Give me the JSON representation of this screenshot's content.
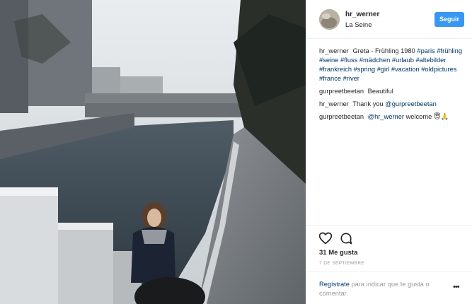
{
  "post": {
    "author": "hr_werner",
    "location": "La Seine",
    "follow_label": "Seguir",
    "caption": {
      "user": "hr_werner",
      "text": "Greta - Frühling 1980",
      "hashtags": [
        "#paris",
        "#frühling",
        "#seine",
        "#fluss",
        "#mädchen",
        "#urlaub",
        "#altebilder",
        "#frankreich",
        "#spring",
        "#girl",
        "#vacation",
        "#oldpictures",
        "#france",
        "#river"
      ]
    },
    "comments": [
      {
        "user": "gurpreetbeetan",
        "text": "Beautiful"
      },
      {
        "user": "hr_werner",
        "text": "Thank you",
        "mention": "@gurpreetbeetan"
      },
      {
        "user": "gurpreetbeetan",
        "mention": "@hr_werner",
        "text": "welcome 😇🙏"
      }
    ],
    "likes": "31 Me gusta",
    "date": "7 de septiembre"
  },
  "login": {
    "link": "Regístrate",
    "text": "para indicar que te gusta o comentar.",
    "more_icon": "ellipsis-icon"
  },
  "icons": {
    "like": "heart-outline-icon",
    "comment": "speech-bubble-icon"
  },
  "colors": {
    "accent": "#3897f0",
    "link": "#003569",
    "muted": "#999999"
  }
}
